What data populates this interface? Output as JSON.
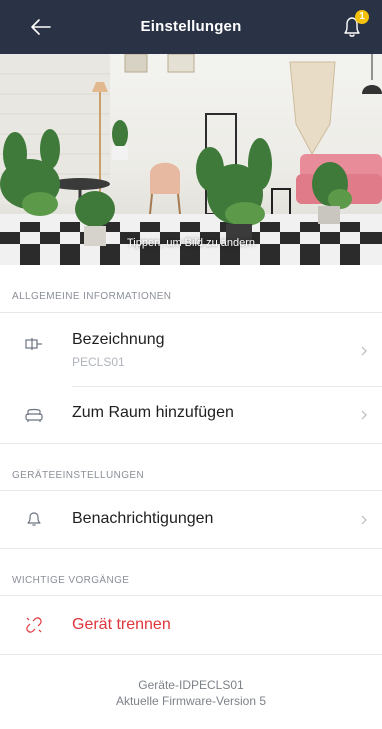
{
  "header": {
    "title": "Einstellungen",
    "notification_count": "1",
    "back_icon": "back-arrow-icon",
    "bell_icon": "bell-icon",
    "badge_color": "#f4c20d",
    "background": "#2a3245"
  },
  "hero": {
    "caption": "Tippen, um Bild zu ändern"
  },
  "sections": {
    "general": {
      "header": "ALLGEMEINE INFORMATIONEN",
      "name_label": "Bezeichnung",
      "name_value": "PECLS01",
      "room_label": "Zum Raum hinzufügen"
    },
    "device_settings": {
      "header": "GERÄTEEINSTELLUNGEN",
      "notifications_label": "Benachrichtigungen"
    },
    "important": {
      "header": "WICHTIGE VORGÄNGE",
      "disconnect_label": "Gerät trennen",
      "danger_color": "#e0353c"
    }
  },
  "footer": {
    "device_id": "Geräte-IDPECLS01",
    "firmware": "Aktuelle Firmware-Version 5"
  }
}
